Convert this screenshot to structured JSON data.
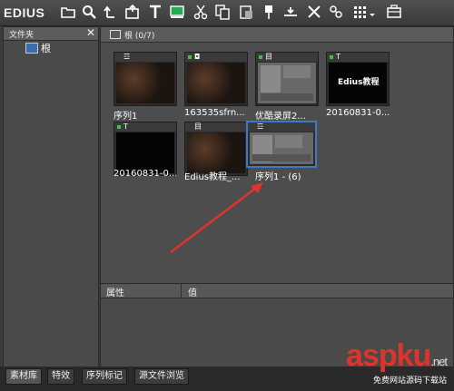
{
  "app": {
    "logo": "EDIUS"
  },
  "toolbar": {
    "icons": [
      "folder-open-icon",
      "search-icon",
      "up-icon",
      "export-icon",
      "text-icon",
      "clip-icon",
      "cut-icon",
      "copy-icon",
      "paste-icon",
      "pin-icon",
      "marker-icon",
      "delete-icon",
      "properties-icon",
      "view-icon",
      "settings-icon"
    ]
  },
  "folder_panel": {
    "title": "文件夹",
    "close": "✕",
    "root_label": "根"
  },
  "bin": {
    "header": "根 (0/7)",
    "clips": [
      {
        "type_icon": "☲",
        "caption": "序列1",
        "has_green": false
      },
      {
        "type_icon": "◘",
        "caption": "163535sfrn...",
        "has_green": true
      },
      {
        "type_icon": "目",
        "caption": "优酷录屏2...",
        "has_green": true
      },
      {
        "type_icon": "T",
        "caption": "20160831-0...",
        "has_green": true,
        "thumb_text": "Edius教程"
      },
      {
        "type_icon": "T",
        "caption": "20160831-0...",
        "has_green": true
      },
      {
        "type_icon": "目",
        "caption": "Edius教程_...",
        "has_green": false
      },
      {
        "type_icon": "☲",
        "caption": "序列1 - (6)",
        "has_green": false,
        "selected": true
      }
    ]
  },
  "properties": {
    "col1": "属性",
    "col2": "值"
  },
  "tabs": [
    "素材库",
    "特效",
    "序列标记",
    "源文件浏览"
  ],
  "watermark": {
    "brand": "aspku",
    "suffix": ".net",
    "tagline": "免费网站源码下载站"
  },
  "colors": {
    "selection": "#3f78c6",
    "online": "#3cc43c",
    "arrow": "#e0332b"
  }
}
